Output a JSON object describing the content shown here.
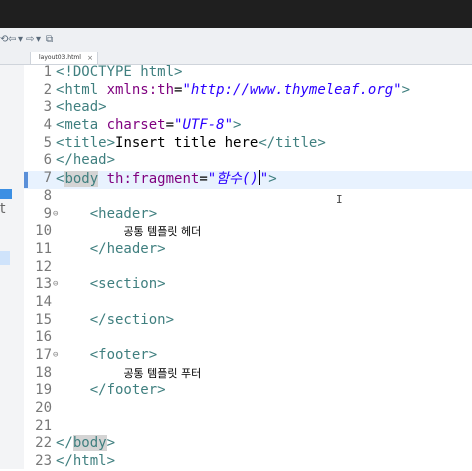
{
  "tab": {
    "label": "layout03.html",
    "close": "×"
  },
  "left_panel": {
    "letter": "t"
  },
  "lines": [
    {
      "n": "1",
      "parts": [
        [
          "tag",
          "<!DOCTYPE html>"
        ]
      ]
    },
    {
      "n": "2",
      "parts": [
        [
          "tag",
          "<html "
        ],
        [
          "attr",
          "xmlns:th"
        ],
        [
          "plain",
          "="
        ],
        [
          "val",
          "\"http://www.thymeleaf.org\""
        ],
        [
          "tag",
          ">"
        ]
      ]
    },
    {
      "n": "3",
      "parts": [
        [
          "tag",
          "<head>"
        ]
      ]
    },
    {
      "n": "4",
      "parts": [
        [
          "tag",
          "<meta "
        ],
        [
          "attr",
          "charset"
        ],
        [
          "plain",
          "="
        ],
        [
          "val",
          "\"UTF-8\""
        ],
        [
          "tag",
          ">"
        ]
      ]
    },
    {
      "n": "5",
      "parts": [
        [
          "tag",
          "<title>"
        ],
        [
          "plain",
          "Insert title here"
        ],
        [
          "tag",
          "</title>"
        ]
      ]
    },
    {
      "n": "6",
      "parts": [
        [
          "tag",
          "</head>"
        ]
      ]
    },
    {
      "n": "7",
      "parts": [
        [
          "tag",
          "<"
        ],
        [
          "taghl",
          "body"
        ],
        [
          "tag",
          " "
        ],
        [
          "attr",
          "th:fragment"
        ],
        [
          "plain",
          "="
        ],
        [
          "val",
          "\"함수()"
        ],
        [
          "cursor",
          ""
        ],
        [
          "val",
          "\""
        ],
        [
          "tag",
          ">"
        ]
      ],
      "current": true
    },
    {
      "n": "8",
      "parts": []
    },
    {
      "n": "9",
      "fold": true,
      "parts": [
        [
          "plain",
          "    "
        ],
        [
          "tag",
          "<header>"
        ]
      ]
    },
    {
      "n": "10",
      "parts": [
        [
          "plain",
          "        "
        ],
        [
          "ko",
          "공통 템플릿 헤더"
        ]
      ]
    },
    {
      "n": "11",
      "parts": [
        [
          "plain",
          "    "
        ],
        [
          "tag",
          "</header>"
        ]
      ]
    },
    {
      "n": "12",
      "parts": []
    },
    {
      "n": "13",
      "fold": true,
      "parts": [
        [
          "plain",
          "    "
        ],
        [
          "tag",
          "<section>"
        ]
      ]
    },
    {
      "n": "14",
      "parts": []
    },
    {
      "n": "15",
      "parts": [
        [
          "plain",
          "    "
        ],
        [
          "tag",
          "</section>"
        ]
      ]
    },
    {
      "n": "16",
      "parts": []
    },
    {
      "n": "17",
      "fold": true,
      "parts": [
        [
          "plain",
          "    "
        ],
        [
          "tag",
          "<footer>"
        ]
      ]
    },
    {
      "n": "18",
      "parts": [
        [
          "plain",
          "        "
        ],
        [
          "ko",
          "공통 템플릿 푸터"
        ]
      ]
    },
    {
      "n": "19",
      "parts": [
        [
          "plain",
          "    "
        ],
        [
          "tag",
          "</footer>"
        ]
      ]
    },
    {
      "n": "20",
      "parts": []
    },
    {
      "n": "21",
      "parts": []
    },
    {
      "n": "22",
      "parts": [
        [
          "tag",
          "</"
        ],
        [
          "taghl",
          "body"
        ],
        [
          "tag",
          ">"
        ]
      ]
    },
    {
      "n": "23",
      "parts": [
        [
          "tag",
          "</html>"
        ]
      ]
    }
  ]
}
